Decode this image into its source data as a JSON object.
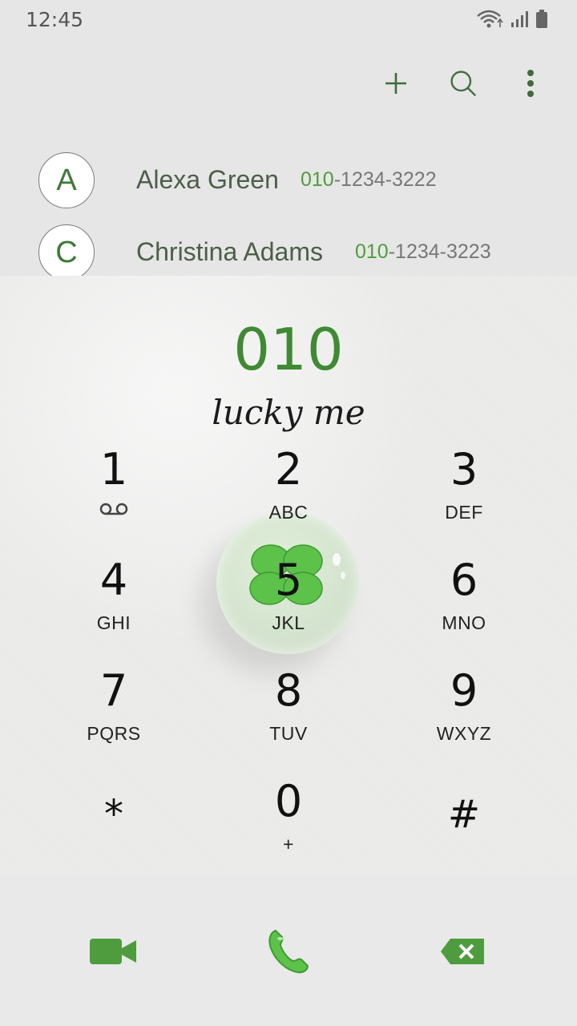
{
  "status_bar": {
    "time": "12:45"
  },
  "toolbar": {
    "add_icon": "plus-icon",
    "search_icon": "search-icon",
    "more_icon": "more-vert-icon"
  },
  "contacts": [
    {
      "initial": "A",
      "name": "Alexa Green",
      "number_prefix": "010",
      "number_rest": "-1234-3222"
    },
    {
      "initial": "C",
      "name": "Christina Adams",
      "number_prefix": "010",
      "number_rest": "-1234-3223"
    }
  ],
  "dialer": {
    "digits": "010",
    "tagline": "lucky me"
  },
  "keys": [
    {
      "num": "1",
      "sub": ""
    },
    {
      "num": "2",
      "sub": "ABC"
    },
    {
      "num": "3",
      "sub": "DEF"
    },
    {
      "num": "4",
      "sub": "GHI"
    },
    {
      "num": "5",
      "sub": "JKL"
    },
    {
      "num": "6",
      "sub": "MNO"
    },
    {
      "num": "7",
      "sub": "PQRS"
    },
    {
      "num": "8",
      "sub": "TUV"
    },
    {
      "num": "9",
      "sub": "WXYZ"
    },
    {
      "num": "*",
      "sub": ""
    },
    {
      "num": "0",
      "sub": "+"
    },
    {
      "num": "#",
      "sub": ""
    }
  ],
  "colors": {
    "accent": "#4f9c3e",
    "clover": "#5cc24a"
  }
}
